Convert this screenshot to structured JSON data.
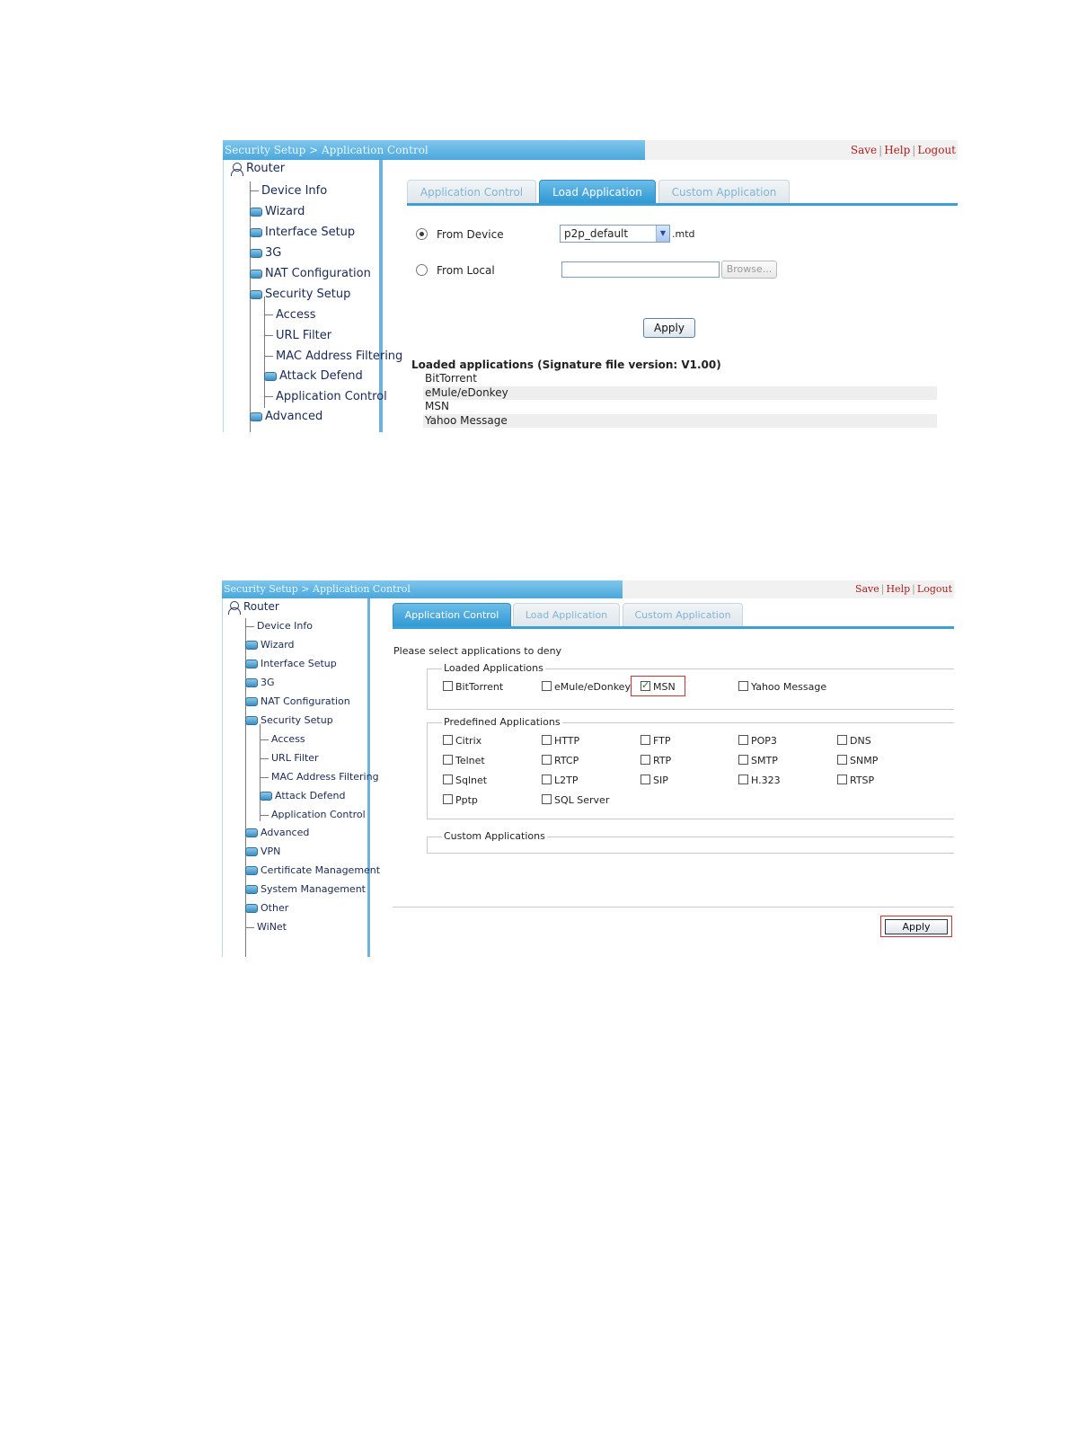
{
  "shot1": {
    "breadcrumb": "Security Setup > Application Control",
    "links": [
      "Save",
      "Help",
      "Logout"
    ],
    "tree_root": "Router",
    "tree_items": [
      "Device Info",
      "Wizard",
      "Interface Setup",
      "3G",
      "NAT Configuration",
      "Security Setup",
      "Access",
      "URL Filter",
      "MAC Address Filtering",
      "Attack Defend",
      "Application Control",
      "Advanced"
    ],
    "tabs": [
      "Application Control",
      "Load Application",
      "Custom Application"
    ],
    "active_tab": "Load Application",
    "from_device_label": "From Device",
    "from_device_selected": true,
    "device_file_value": "p2p_default",
    "device_file_ext": ".mtd",
    "from_local_label": "From Local",
    "from_local_value": "",
    "browse_label": "Browse...",
    "apply_label": "Apply",
    "loaded_title": "Loaded applications (Signature file version: V1.00)",
    "loaded_apps": [
      "BitTorrent",
      "eMule/eDonkey",
      "MSN",
      "Yahoo Message"
    ]
  },
  "shot2": {
    "breadcrumb": "Security Setup > Application Control",
    "links": [
      "Save",
      "Help",
      "Logout"
    ],
    "tree_root": "Router",
    "tree_items": [
      "Device Info",
      "Wizard",
      "Interface Setup",
      "3G",
      "NAT Configuration",
      "Security Setup",
      "Access",
      "URL Filter",
      "MAC Address Filtering",
      "Attack Defend",
      "Application Control",
      "Advanced",
      "VPN",
      "Certificate Management",
      "System Management",
      "Other",
      "WiNet"
    ],
    "tabs": [
      "Application Control",
      "Load Application",
      "Custom Application"
    ],
    "active_tab": "Application Control",
    "prompt": "Please select applications to deny",
    "loaded_legend": "Loaded Applications",
    "loaded_apps": [
      {
        "label": "BitTorrent",
        "checked": false
      },
      {
        "label": "eMule/eDonkey",
        "checked": false
      },
      {
        "label": "MSN",
        "checked": true
      },
      {
        "label": "Yahoo Message",
        "checked": false
      }
    ],
    "predefined_legend": "Predefined Applications",
    "predefined_apps": [
      {
        "label": "Citrix",
        "checked": false
      },
      {
        "label": "HTTP",
        "checked": false
      },
      {
        "label": "FTP",
        "checked": false
      },
      {
        "label": "POP3",
        "checked": false
      },
      {
        "label": "DNS",
        "checked": false
      },
      {
        "label": "Telnet",
        "checked": false
      },
      {
        "label": "RTCP",
        "checked": false
      },
      {
        "label": "RTP",
        "checked": false
      },
      {
        "label": "SMTP",
        "checked": false
      },
      {
        "label": "SNMP",
        "checked": false
      },
      {
        "label": "Sqlnet",
        "checked": false
      },
      {
        "label": "L2TP",
        "checked": false
      },
      {
        "label": "SIP",
        "checked": false
      },
      {
        "label": "H.323",
        "checked": false
      },
      {
        "label": "RTSP",
        "checked": false
      },
      {
        "label": "Pptp",
        "checked": false
      },
      {
        "label": "SQL Server",
        "checked": false
      }
    ],
    "custom_legend": "Custom Applications",
    "apply_label": "Apply"
  },
  "colors": {
    "header_blue": "#4aa8dc",
    "active_tab_blue": "#2f98d3",
    "link_red": "#b31b1b",
    "highlight_red": "#cc3333"
  },
  "icons": [
    "router-icon",
    "folder-icon",
    "dropdown-arrow-icon",
    "radio-icon",
    "checkbox-icon"
  ]
}
